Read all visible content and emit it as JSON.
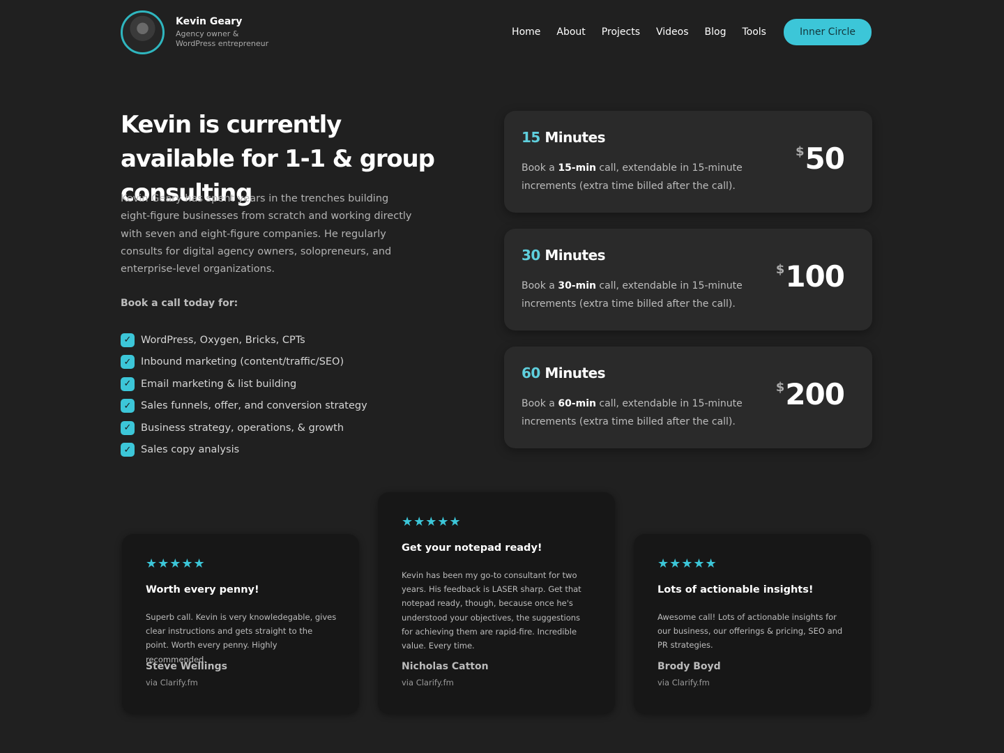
{
  "header": {
    "name": "Kevin Geary",
    "tagline": "Agency owner & WordPress entrepreneur",
    "nav": [
      "Home",
      "About",
      "Projects",
      "Videos",
      "Blog",
      "Tools"
    ],
    "cta": "Inner Circle"
  },
  "hero": {
    "title": "Kevin is currently available for 1-1 & group consulting",
    "intro": "Kevin Geary has spent years in the trenches building eight-figure businesses from scratch and working directly with seven and eight-figure companies. He regularly consults for digital agency owners, solopreneurs, and enterprise-level organizations.",
    "book_label": "Book a call today for:",
    "topics": [
      "WordPress, Oxygen, Bricks, CPTs",
      "Inbound marketing (content/traffic/SEO)",
      "Email marketing & list building",
      "Sales funnels, offer, and conversion strategy",
      "Business strategy, operations, & growth",
      "Sales copy analysis"
    ]
  },
  "pricing": [
    {
      "num": "15",
      "unit": "Minutes",
      "pre": "Book a ",
      "bold": "15-min",
      "post": " call, extendable in 15-minute increments (extra time billed after the call).",
      "currency": "$",
      "amount": "50"
    },
    {
      "num": "30",
      "unit": "Minutes",
      "pre": "Book a ",
      "bold": "30-min",
      "post": " call, extendable in 15-minute increments (extra time billed after the call).",
      "currency": "$",
      "amount": "100"
    },
    {
      "num": "60",
      "unit": "Minutes",
      "pre": "Book a ",
      "bold": "60-min",
      "post": " call, extendable in 15-minute increments (extra time billed after the call).",
      "currency": "$",
      "amount": "200"
    }
  ],
  "testimonials": [
    {
      "rating": 5,
      "stars": "★★★★★",
      "title": "Worth every penny!",
      "quote": "Superb call. Kevin is very knowledegable, gives clear instructions and gets straight to the point. Worth every penny. Highly recommended.",
      "author": "Steve Wellings",
      "source": "via Clarify.fm"
    },
    {
      "rating": 5,
      "stars": "★★★★★",
      "title": "Get your notepad ready!",
      "quote": "Kevin has been my go-to consultant for two years. His feedback is LASER sharp. Get that notepad ready, though, because once he's understood your objectives, the suggestions for achieving them are rapid-fire. Incredible value. Every time.",
      "author": "Nicholas Catton",
      "source": "via Clarify.fm"
    },
    {
      "rating": 5,
      "stars": "★★★★★",
      "title": "Lots of actionable insights!",
      "quote": "Awesome call! Lots of actionable insights for our business, our offerings & pricing, SEO and PR strategies.",
      "author": "Brody Boyd",
      "source": "via Clarify.fm"
    }
  ],
  "colors": {
    "accent": "#3cc6d8",
    "background": "#202020",
    "card": "#2a2a2a",
    "testimonial_card": "#171717"
  }
}
